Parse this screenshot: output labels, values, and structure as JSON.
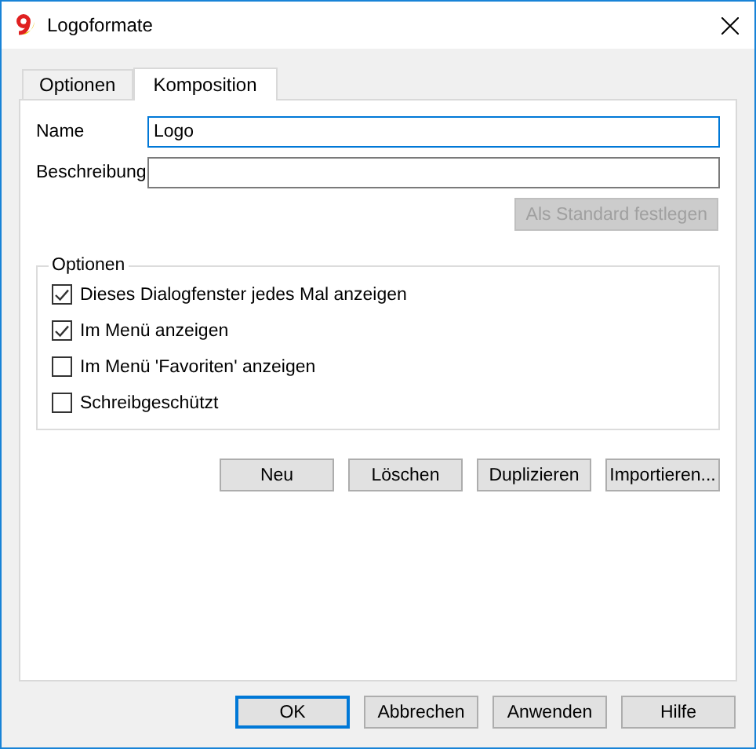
{
  "window": {
    "title": "Logoformate"
  },
  "tabs": [
    {
      "label": "Optionen",
      "selected": false
    },
    {
      "label": "Komposition",
      "selected": true
    }
  ],
  "fields": [
    {
      "label": "Name",
      "value": "Logo",
      "focused": true
    },
    {
      "label": "Beschreibung",
      "focused": false
    }
  ],
  "set_default_button": {
    "label": "Als Standard festlegen",
    "disabled": true
  },
  "options_group": {
    "title": "Optionen",
    "items": [
      {
        "label": "Dieses Dialogfenster jedes Mal anzeigen",
        "checked": true
      },
      {
        "label": "Im Menü anzeigen",
        "checked": true
      },
      {
        "label": "Im Menü 'Favoriten' anzeigen",
        "checked": false
      },
      {
        "label": "Schreibgeschützt",
        "checked": false
      }
    ]
  },
  "action_buttons": [
    "Neu",
    "Löschen",
    "Duplizieren",
    "Importieren..."
  ],
  "dialog_buttons": [
    {
      "label": "OK",
      "default": true
    },
    {
      "label": "Abbrechen",
      "default": false
    },
    {
      "label": "Anwenden",
      "default": false
    },
    {
      "label": "Hilfe",
      "default": false
    }
  ]
}
